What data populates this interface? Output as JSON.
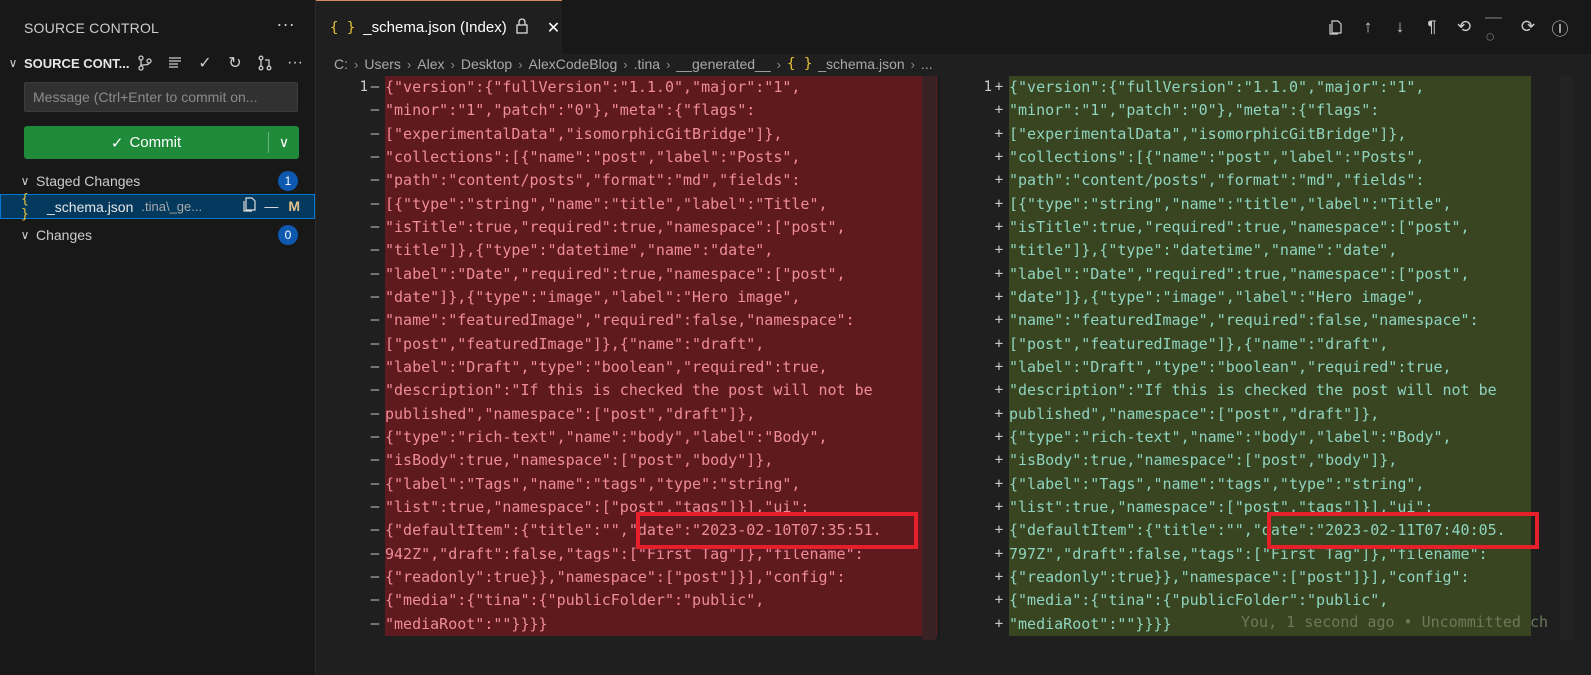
{
  "sidebar": {
    "title": "SOURCE CONTROL",
    "repo_title": "SOURCE CONT...",
    "message_placeholder": "Message (Ctrl+Enter to commit on...",
    "commit_label": "Commit",
    "staged": {
      "label": "Staged Changes",
      "count": "1"
    },
    "staged_file": {
      "name": "_schema.json",
      "path": ".tina\\_ge...",
      "status": "M"
    },
    "changes": {
      "label": "Changes",
      "count": "0"
    }
  },
  "tab": {
    "label": "_schema.json (Index)"
  },
  "breadcrumb": [
    "C:",
    "Users",
    "Alex",
    "Desktop",
    "AlexCodeBlog",
    ".tina",
    "__generated__",
    "_schema.json",
    "..."
  ],
  "left_lines": [
    "{\"version\":{\"fullVersion\":\"1.1.0\",\"major\":\"1\",",
    "\"minor\":\"1\",\"patch\":\"0\"},\"meta\":{\"flags\":",
    "[\"experimentalData\",\"isomorphicGitBridge\"]},",
    "\"collections\":[{\"name\":\"post\",\"label\":\"Posts\",",
    "\"path\":\"content/posts\",\"format\":\"md\",\"fields\":",
    "[{\"type\":\"string\",\"name\":\"title\",\"label\":\"Title\",",
    "\"isTitle\":true,\"required\":true,\"namespace\":[\"post\",",
    "\"title\"]},{\"type\":\"datetime\",\"name\":\"date\",",
    "\"label\":\"Date\",\"required\":true,\"namespace\":[\"post\",",
    "\"date\"]},{\"type\":\"image\",\"label\":\"Hero image\",",
    "\"name\":\"featuredImage\",\"required\":false,\"namespace\":",
    "[\"post\",\"featuredImage\"]},{\"name\":\"draft\",",
    "\"label\":\"Draft\",\"type\":\"boolean\",\"required\":true,",
    "\"description\":\"If this is checked the post will not be",
    "published\",\"namespace\":[\"post\",\"draft\"]},",
    "{\"type\":\"rich-text\",\"name\":\"body\",\"label\":\"Body\",",
    "\"isBody\":true,\"namespace\":[\"post\",\"body\"]},",
    "{\"label\":\"Tags\",\"name\":\"tags\",\"type\":\"string\",",
    "\"list\":true,\"namespace\":[\"post\",\"tags\"]}],\"ui\":",
    "{\"defaultItem\":{\"title\":\"\",\"date\":\"2023-02-10T07:35:51.",
    "942Z\",\"draft\":false,\"tags\":[\"First Tag\"]},\"filename\":",
    "{\"readonly\":true}},\"namespace\":[\"post\"]}],\"config\":",
    "{\"media\":{\"tina\":{\"publicFolder\":\"public\",",
    "\"mediaRoot\":\"\"}}}}"
  ],
  "right_lines": [
    "{\"version\":{\"fullVersion\":\"1.1.0\",\"major\":\"1\",",
    "\"minor\":\"1\",\"patch\":\"0\"},\"meta\":{\"flags\":",
    "[\"experimentalData\",\"isomorphicGitBridge\"]},",
    "\"collections\":[{\"name\":\"post\",\"label\":\"Posts\",",
    "\"path\":\"content/posts\",\"format\":\"md\",\"fields\":",
    "[{\"type\":\"string\",\"name\":\"title\",\"label\":\"Title\",",
    "\"isTitle\":true,\"required\":true,\"namespace\":[\"post\",",
    "\"title\"]},{\"type\":\"datetime\",\"name\":\"date\",",
    "\"label\":\"Date\",\"required\":true,\"namespace\":[\"post\",",
    "\"date\"]},{\"type\":\"image\",\"label\":\"Hero image\",",
    "\"name\":\"featuredImage\",\"required\":false,\"namespace\":",
    "[\"post\",\"featuredImage\"]},{\"name\":\"draft\",",
    "\"label\":\"Draft\",\"type\":\"boolean\",\"required\":true,",
    "\"description\":\"If this is checked the post will not be",
    "published\",\"namespace\":[\"post\",\"draft\"]},",
    "{\"type\":\"rich-text\",\"name\":\"body\",\"label\":\"Body\",",
    "\"isBody\":true,\"namespace\":[\"post\",\"body\"]},",
    "{\"label\":\"Tags\",\"name\":\"tags\",\"type\":\"string\",",
    "\"list\":true,\"namespace\":[\"post\",\"tags\"]}],\"ui\":",
    "{\"defaultItem\":{\"title\":\"\",\"date\":\"2023-02-11T07:40:05.",
    "797Z\",\"draft\":false,\"tags\":[\"First Tag\"]},\"filename\":",
    "{\"readonly\":true}},\"namespace\":[\"post\"]}],\"config\":",
    "{\"media\":{\"tina\":{\"publicFolder\":\"public\",",
    "\"mediaRoot\":\"\"}}}}"
  ],
  "gutter": {
    "line_number": "1",
    "left_marker": "—",
    "right_marker": "+"
  },
  "blame": "You, 1 second ago • Uncommitted ch",
  "icons": {
    "json_file": "{ }",
    "more": "···",
    "chevron_down": "chevron-down-icon",
    "check": "check-icon"
  },
  "colors": {
    "removed_bg": "#5e1a1f",
    "added_bg": "#394520",
    "commit_button": "#1f8a39",
    "highlight_box": "#e5202b",
    "badge": "#0d59b0"
  }
}
